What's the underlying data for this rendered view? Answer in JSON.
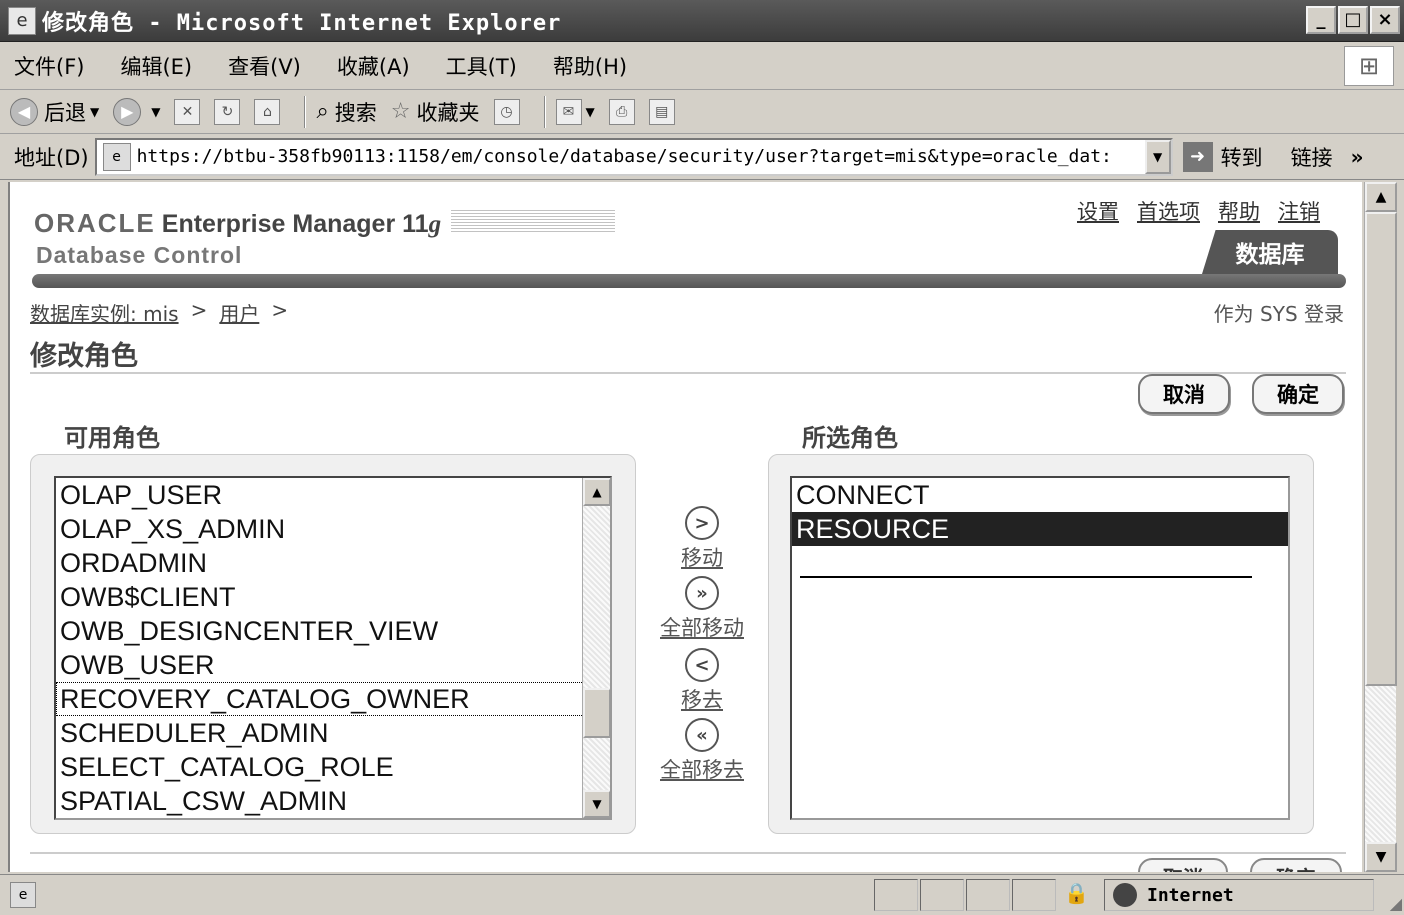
{
  "window": {
    "title": "修改角色 - Microsoft Internet Explorer",
    "minimize": "_",
    "maximize": "□",
    "close": "×"
  },
  "menu": [
    "文件(F)",
    "编辑(E)",
    "查看(V)",
    "收藏(A)",
    "工具(T)",
    "帮助(H)"
  ],
  "toolbar": {
    "back": "后退",
    "search": "搜索",
    "favorites": "收藏夹"
  },
  "address": {
    "label": "地址(D)",
    "url": "https://btbu-358fb90113:1158/em/console/database/security/user?target=mis&type=oracle_dat:",
    "go": "转到",
    "links": "链接"
  },
  "header": {
    "brand": "ORACLE",
    "product": "Enterprise Manager 11",
    "product_suffix": "g",
    "subtitle": "Database Control",
    "links": [
      "设置",
      "首选项",
      "帮助",
      "注销"
    ],
    "tab": "数据库"
  },
  "breadcrumb": {
    "instance": "数据库实例: mis",
    "sep": ">",
    "users": "用户"
  },
  "logged_in": "作为 SYS 登录",
  "page_title": "修改角色",
  "buttons": {
    "cancel": "取消",
    "ok": "确定"
  },
  "available": {
    "heading": "可用角色",
    "items": [
      "OLAP_USER",
      "OLAP_XS_ADMIN",
      "ORDADMIN",
      "OWB$CLIENT",
      "OWB_DESIGNCENTER_VIEW",
      "OWB_USER",
      "RECOVERY_CATALOG_OWNER",
      "SCHEDULER_ADMIN",
      "SELECT_CATALOG_ROLE",
      "SPATIAL_CSW_ADMIN"
    ],
    "focused_index": 6
  },
  "selected": {
    "heading": "所选角色",
    "items": [
      "CONNECT",
      "RESOURCE"
    ],
    "highlighted_index": 1
  },
  "move": {
    "move": "移动",
    "move_all": "全部移动",
    "remove": "移去",
    "remove_all": "全部移去"
  },
  "status": {
    "zone": "Internet"
  }
}
